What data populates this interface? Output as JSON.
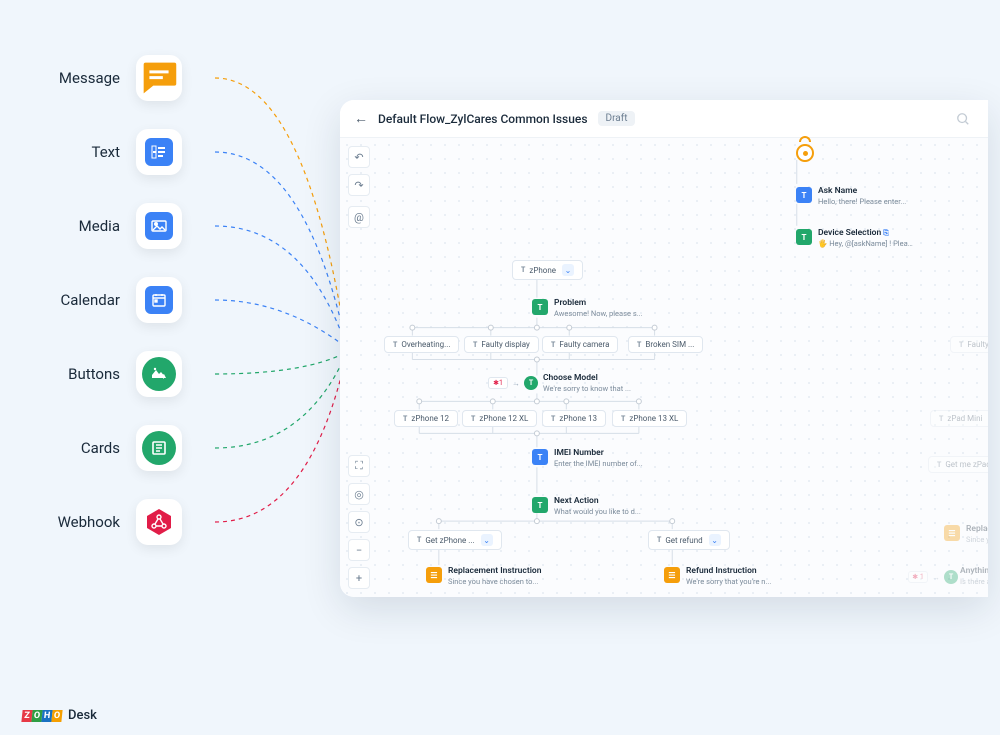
{
  "palette": {
    "items": [
      {
        "label": "Message"
      },
      {
        "label": "Text"
      },
      {
        "label": "Media"
      },
      {
        "label": "Calendar"
      },
      {
        "label": "Buttons"
      },
      {
        "label": "Cards"
      },
      {
        "label": "Webhook"
      }
    ]
  },
  "panel": {
    "title": "Default Flow_ZylCares Common Issues",
    "status": "Draft"
  },
  "flow": {
    "ask_name": {
      "title": "Ask Name",
      "sub": "Hello, there! Please enter..."
    },
    "device_selection": {
      "title": "Device Selection",
      "sub": "Hey, @[askName] ! Plea..."
    },
    "zphone_pill": "zPhone",
    "problem": {
      "title": "Problem",
      "sub": "Awesome! Now, please s..."
    },
    "issues": [
      "Overheating...",
      "Faulty display",
      "Faulty camera",
      "Broken SIM ..."
    ],
    "choose_model_tag": "1",
    "choose_model": {
      "title": "Choose Model",
      "sub": "We're sorry to know that ..."
    },
    "models": [
      "zPhone 12",
      "zPhone 12 XL",
      "zPhone 13",
      "zPhone 13 XL"
    ],
    "imei": {
      "title": "IMEI Number",
      "sub": "Enter the IMEI number of..."
    },
    "next_action": {
      "title": "Next Action",
      "sub": "What would you like to d..."
    },
    "get_zphone": "Get zPhone ...",
    "get_refund": "Get refund",
    "replacement": {
      "title": "Replacement Instruction",
      "sub": "Since you have chosen to..."
    },
    "refund": {
      "title": "Refund Instruction",
      "sub": "We're sorry that you're n..."
    },
    "ghost_faulty": "Faulty micro...",
    "ghost_zpad": "zPad Mini",
    "ghost_get_zpad": "Get me zPad ...",
    "ghost_replace": {
      "title": "Replacement",
      "sub": "Since you h..."
    },
    "ghost_anything": {
      "title": "Anything E...",
      "sub": "Is there an..."
    }
  },
  "footer": {
    "brand": "Desk"
  }
}
